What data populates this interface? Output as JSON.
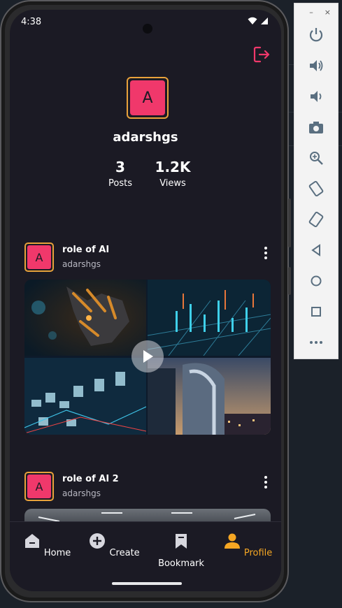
{
  "status": {
    "time": "4:38"
  },
  "profile": {
    "avatar_letter": "A",
    "username": "adarshgs",
    "stats": [
      {
        "value": "3",
        "label": "Posts"
      },
      {
        "value": "1.2K",
        "label": "Views"
      }
    ]
  },
  "posts": [
    {
      "avatar_letter": "A",
      "title": "role of AI",
      "user": "adarshgs",
      "media": "video"
    },
    {
      "avatar_letter": "A",
      "title": "role of AI 2",
      "user": "adarshgs",
      "media": "image"
    }
  ],
  "nav": [
    {
      "label": "Home",
      "icon": "home-icon",
      "active": false
    },
    {
      "label": "Create",
      "icon": "add-circle-icon",
      "active": false
    },
    {
      "label": "Bookmark",
      "icon": "bookmark-icon",
      "active": false
    },
    {
      "label": "Profile",
      "icon": "person-icon",
      "active": true
    }
  ],
  "emulator_toolbar": {
    "minimize": "–",
    "close": "×",
    "buttons": [
      "power-icon",
      "volume-up-icon",
      "volume-down-icon",
      "camera-icon",
      "zoom-icon",
      "rotate-left-icon",
      "rotate-right-icon",
      "back-icon",
      "home-circle-icon",
      "overview-icon",
      "more-icon"
    ]
  },
  "colors": {
    "background": "#1b1a24",
    "accent": "#f5a623",
    "avatar": "#f0386b",
    "logout": "#f0386b"
  }
}
